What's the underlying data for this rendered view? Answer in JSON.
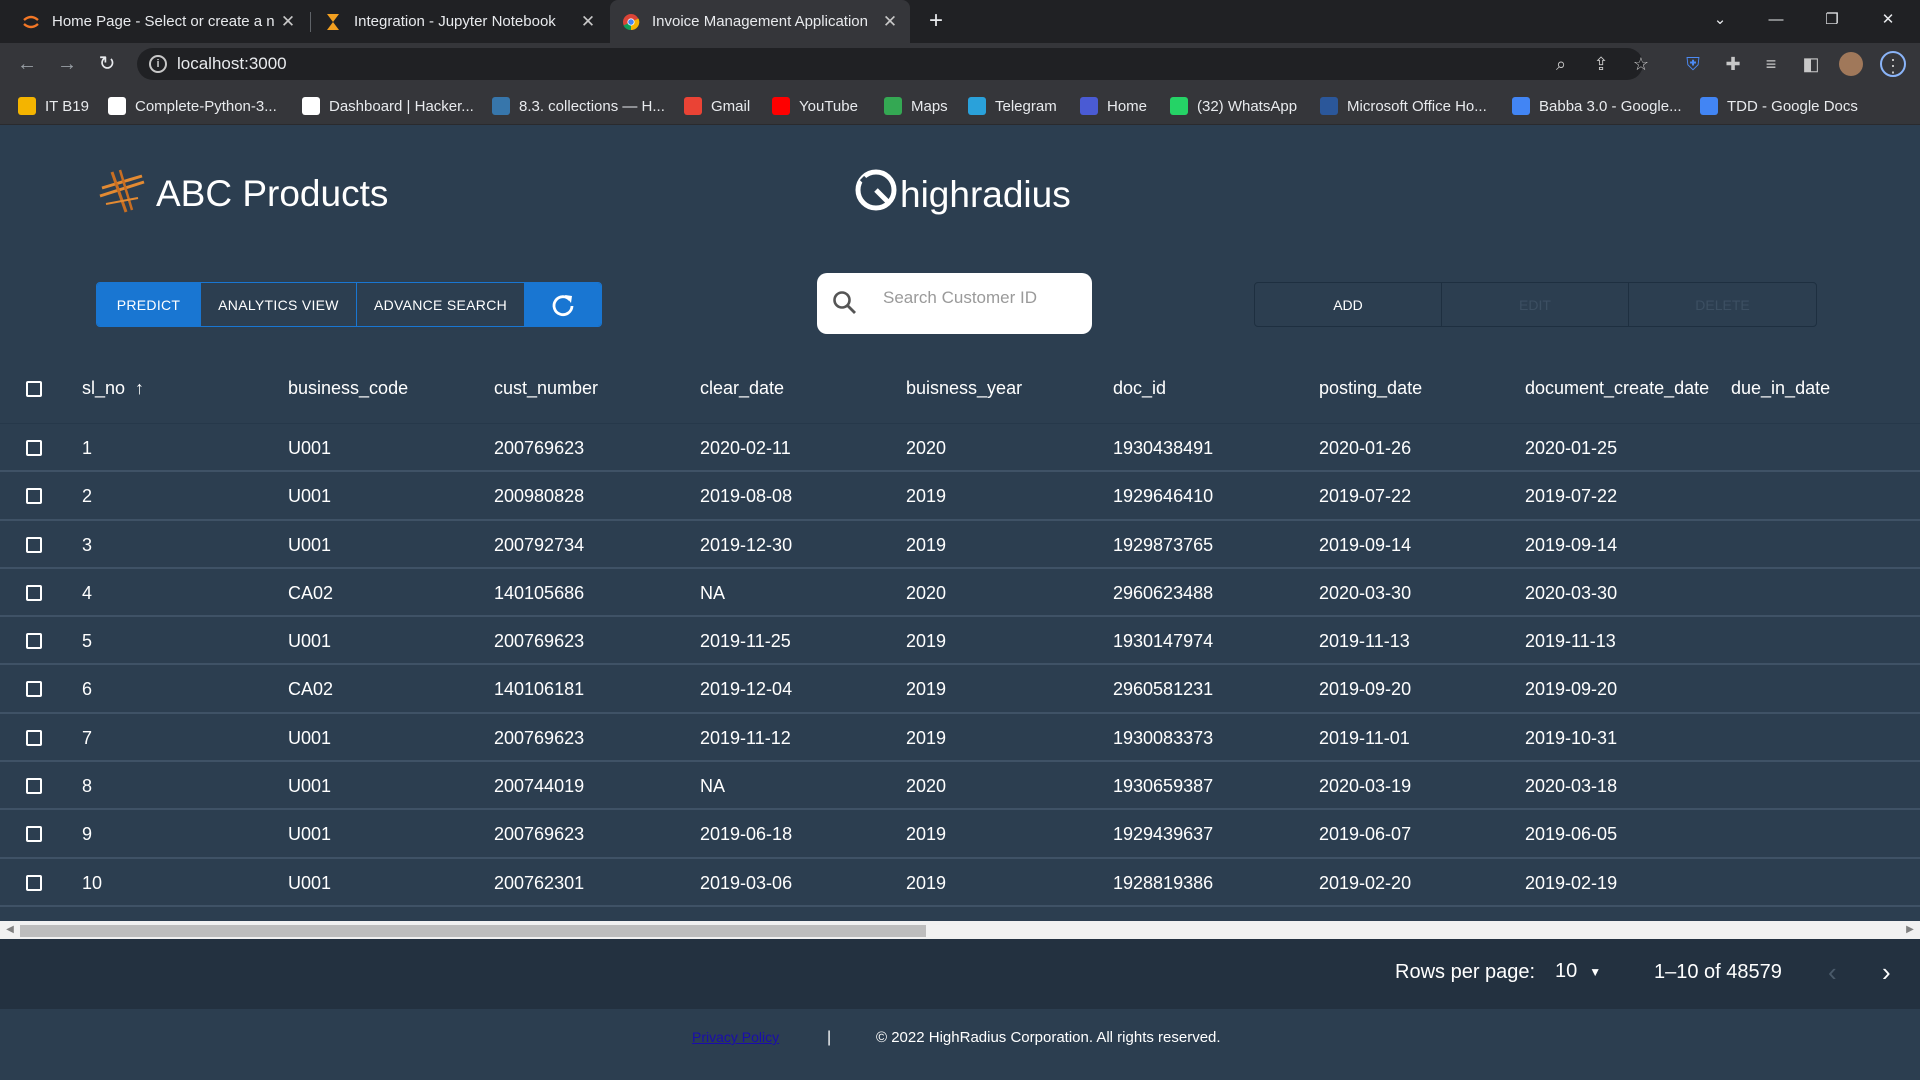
{
  "browser": {
    "tabs": [
      {
        "title": "Home Page - Select or create a n",
        "icon": "jupyter-icon"
      },
      {
        "title": "Integration - Jupyter Notebook",
        "icon": "hourglass-icon"
      },
      {
        "title": "Invoice Management Application",
        "icon": "chrome-icon"
      }
    ],
    "url": "localhost:3000",
    "bookmarks": [
      {
        "label": "IT B19",
        "color": "#f4b400"
      },
      {
        "label": "Complete-Python-3...",
        "color": "#ffffff"
      },
      {
        "label": "Dashboard | Hacker...",
        "color": "#ffffff"
      },
      {
        "label": "8.3. collections — H...",
        "color": "#3776ab"
      },
      {
        "label": "Gmail",
        "color": "#ea4335"
      },
      {
        "label": "YouTube",
        "color": "#ff0000"
      },
      {
        "label": "Maps",
        "color": "#34a853"
      },
      {
        "label": "Telegram",
        "color": "#2aa1da"
      },
      {
        "label": "Home",
        "color": "#4a5bd4"
      },
      {
        "label": "(32) WhatsApp",
        "color": "#25d366"
      },
      {
        "label": "Microsoft Office Ho...",
        "color": "#2b579a"
      },
      {
        "label": "Babba 3.0 - Google...",
        "color": "#4285f4"
      },
      {
        "label": "TDD - Google Docs",
        "color": "#4285f4"
      }
    ]
  },
  "header": {
    "brand": "ABC Products",
    "partner_logo": "highradius"
  },
  "toolbar": {
    "predict": "PREDICT",
    "analytics": "ANALYTICS VIEW",
    "advance_search": "ADVANCE SEARCH",
    "search_placeholder": "Search Customer ID",
    "add": "ADD",
    "edit": "EDIT",
    "delete": "DELETE"
  },
  "table": {
    "columns": [
      "sl_no",
      "business_code",
      "cust_number",
      "clear_date",
      "buisness_year",
      "doc_id",
      "posting_date",
      "document_create_date",
      "due_in_date"
    ],
    "rows": [
      [
        "1",
        "U001",
        "200769623",
        "2020-02-11",
        "2020",
        "1930438491",
        "2020-01-26",
        "2020-01-25"
      ],
      [
        "2",
        "U001",
        "200980828",
        "2019-08-08",
        "2019",
        "1929646410",
        "2019-07-22",
        "2019-07-22"
      ],
      [
        "3",
        "U001",
        "200792734",
        "2019-12-30",
        "2019",
        "1929873765",
        "2019-09-14",
        "2019-09-14"
      ],
      [
        "4",
        "CA02",
        "140105686",
        "NA",
        "2020",
        "2960623488",
        "2020-03-30",
        "2020-03-30"
      ],
      [
        "5",
        "U001",
        "200769623",
        "2019-11-25",
        "2019",
        "1930147974",
        "2019-11-13",
        "2019-11-13"
      ],
      [
        "6",
        "CA02",
        "140106181",
        "2019-12-04",
        "2019",
        "2960581231",
        "2019-09-20",
        "2019-09-20"
      ],
      [
        "7",
        "U001",
        "200769623",
        "2019-11-12",
        "2019",
        "1930083373",
        "2019-11-01",
        "2019-10-31"
      ],
      [
        "8",
        "U001",
        "200744019",
        "NA",
        "2020",
        "1930659387",
        "2020-03-19",
        "2020-03-18"
      ],
      [
        "9",
        "U001",
        "200769623",
        "2019-06-18",
        "2019",
        "1929439637",
        "2019-06-07",
        "2019-06-05"
      ],
      [
        "10",
        "U001",
        "200762301",
        "2019-03-06",
        "2019",
        "1928819386",
        "2019-02-20",
        "2019-02-19"
      ]
    ]
  },
  "pagination": {
    "rows_per_page_label": "Rows per page:",
    "rows_per_page": "10",
    "range": "1–10 of 48579"
  },
  "footer": {
    "privacy": "Privacy Policy",
    "separator": "|",
    "copyright": "© 2022 HighRadius Corporation. All rights reserved."
  },
  "colors": {
    "background": "#2c3e50",
    "primary": "#1976d2",
    "pager": "#233140"
  }
}
